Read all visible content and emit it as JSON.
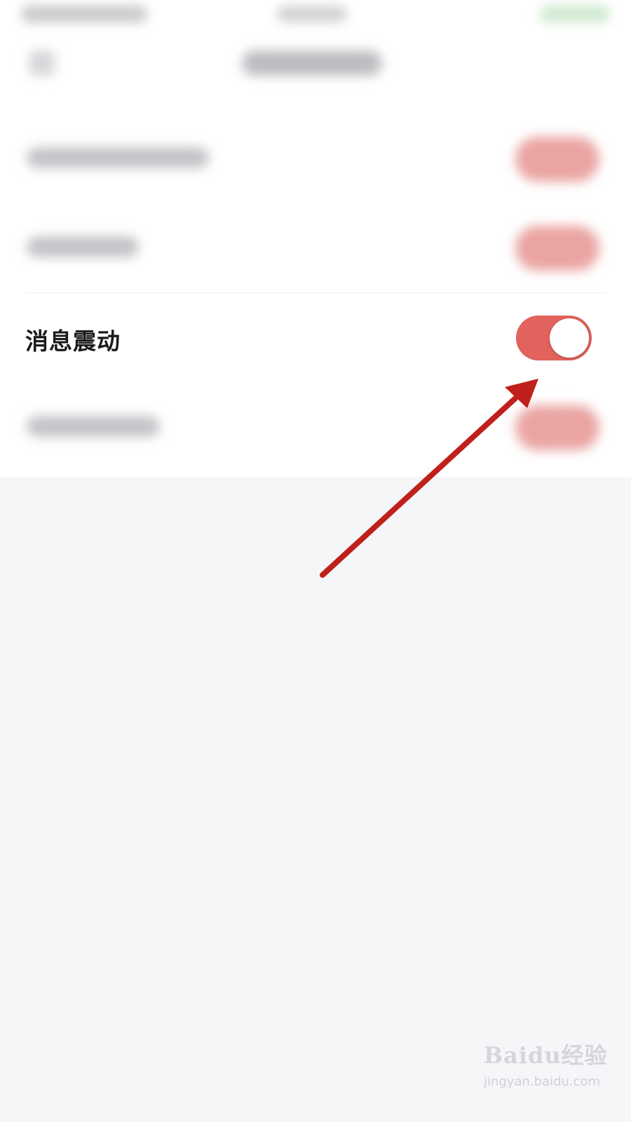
{
  "setting": {
    "label": "消息震动",
    "enabled": true
  },
  "colors": {
    "toggle_on": "#e2625d",
    "arrow": "#c0201b",
    "background": "#f5f6f8",
    "panel": "#ffffff"
  },
  "watermark": {
    "logo": "Baidu经验",
    "url": "jingyan.baidu.com"
  }
}
